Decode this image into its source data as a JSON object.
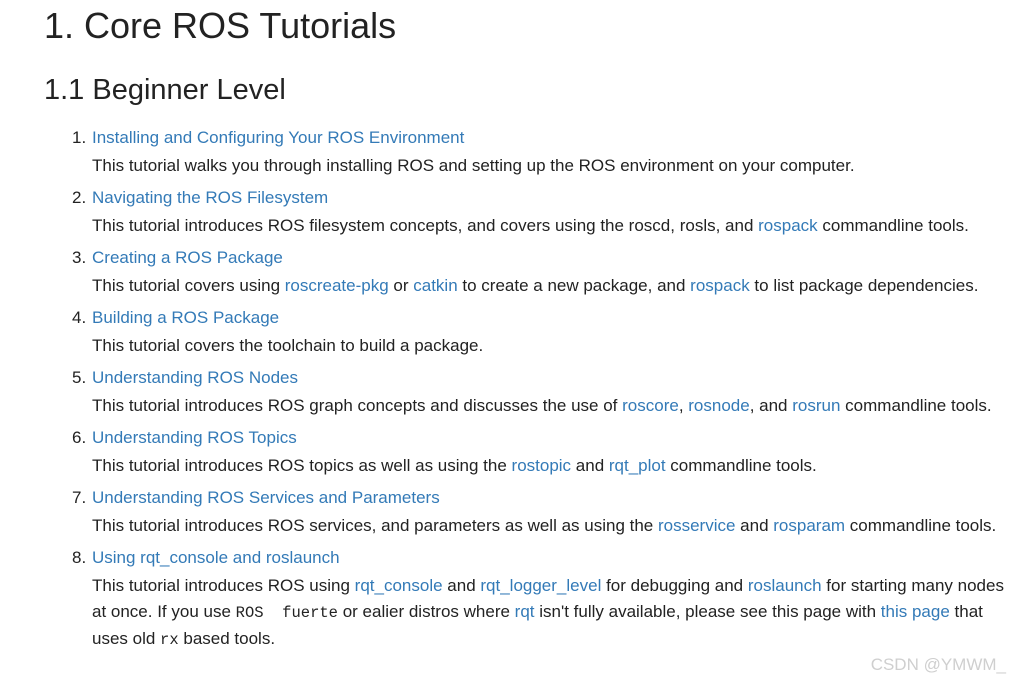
{
  "page_title": "1. Core ROS Tutorials",
  "section_title": "1.1 Beginner Level",
  "tutorials": [
    {
      "number": "1.",
      "title": "Installing and Configuring Your ROS Environment",
      "description": [
        {
          "text": "This tutorial walks you through installing ROS and setting up the ROS environment on your computer."
        }
      ]
    },
    {
      "number": "2.",
      "title": "Navigating the ROS Filesystem",
      "description": [
        {
          "text": "This tutorial introduces ROS filesystem concepts, and covers using the roscd, rosls, and "
        },
        {
          "link": "rospack"
        },
        {
          "text": " commandline tools."
        }
      ]
    },
    {
      "number": "3.",
      "title": "Creating a ROS Package",
      "description": [
        {
          "text": "This tutorial covers using "
        },
        {
          "link": "roscreate-pkg"
        },
        {
          "text": " or "
        },
        {
          "link": "catkin"
        },
        {
          "text": " to create a new package, and "
        },
        {
          "link": "rospack"
        },
        {
          "text": " to list package dependencies."
        }
      ]
    },
    {
      "number": "4.",
      "title": "Building a ROS Package",
      "description": [
        {
          "text": "This tutorial covers the toolchain to build a package."
        }
      ]
    },
    {
      "number": "5.",
      "title": "Understanding ROS Nodes",
      "description": [
        {
          "text": "This tutorial introduces ROS graph concepts and discusses the use of "
        },
        {
          "link": "roscore"
        },
        {
          "text": ", "
        },
        {
          "link": "rosnode"
        },
        {
          "text": ", and "
        },
        {
          "link": "rosrun"
        },
        {
          "text": " commandline tools."
        }
      ]
    },
    {
      "number": "6.",
      "title": "Understanding ROS Topics",
      "description": [
        {
          "text": "This tutorial introduces ROS topics as well as using the "
        },
        {
          "link": "rostopic"
        },
        {
          "text": " and "
        },
        {
          "link": "rqt_plot"
        },
        {
          "text": " commandline tools."
        }
      ]
    },
    {
      "number": "7.",
      "title": "Understanding ROS Services and Parameters",
      "description": [
        {
          "text": "This tutorial introduces ROS services, and parameters as well as using the "
        },
        {
          "link": "rosservice"
        },
        {
          "text": " and "
        },
        {
          "link": "rosparam"
        },
        {
          "text": " commandline tools."
        }
      ]
    },
    {
      "number": "8.",
      "title": "Using rqt_console and roslaunch",
      "description": [
        {
          "text": "This tutorial introduces ROS using "
        },
        {
          "link": "rqt_console"
        },
        {
          "text": " and "
        },
        {
          "link": "rqt_logger_level"
        },
        {
          "text": " for debugging and "
        },
        {
          "link": "roslaunch"
        },
        {
          "text": " for starting many nodes at once. If you use "
        },
        {
          "code": "ROS  fuerte"
        },
        {
          "text": " or ealier distros where "
        },
        {
          "link": "rqt"
        },
        {
          "text": " isn't fully available, please see this page with "
        },
        {
          "link": "this page"
        },
        {
          "text": " that uses old "
        },
        {
          "code": "rx"
        },
        {
          "text": " based tools."
        }
      ]
    }
  ],
  "watermark": "CSDN @YMWM_",
  "colors": {
    "link": "#337ab7",
    "text": "#222222",
    "watermark": "#cfcfcf"
  }
}
